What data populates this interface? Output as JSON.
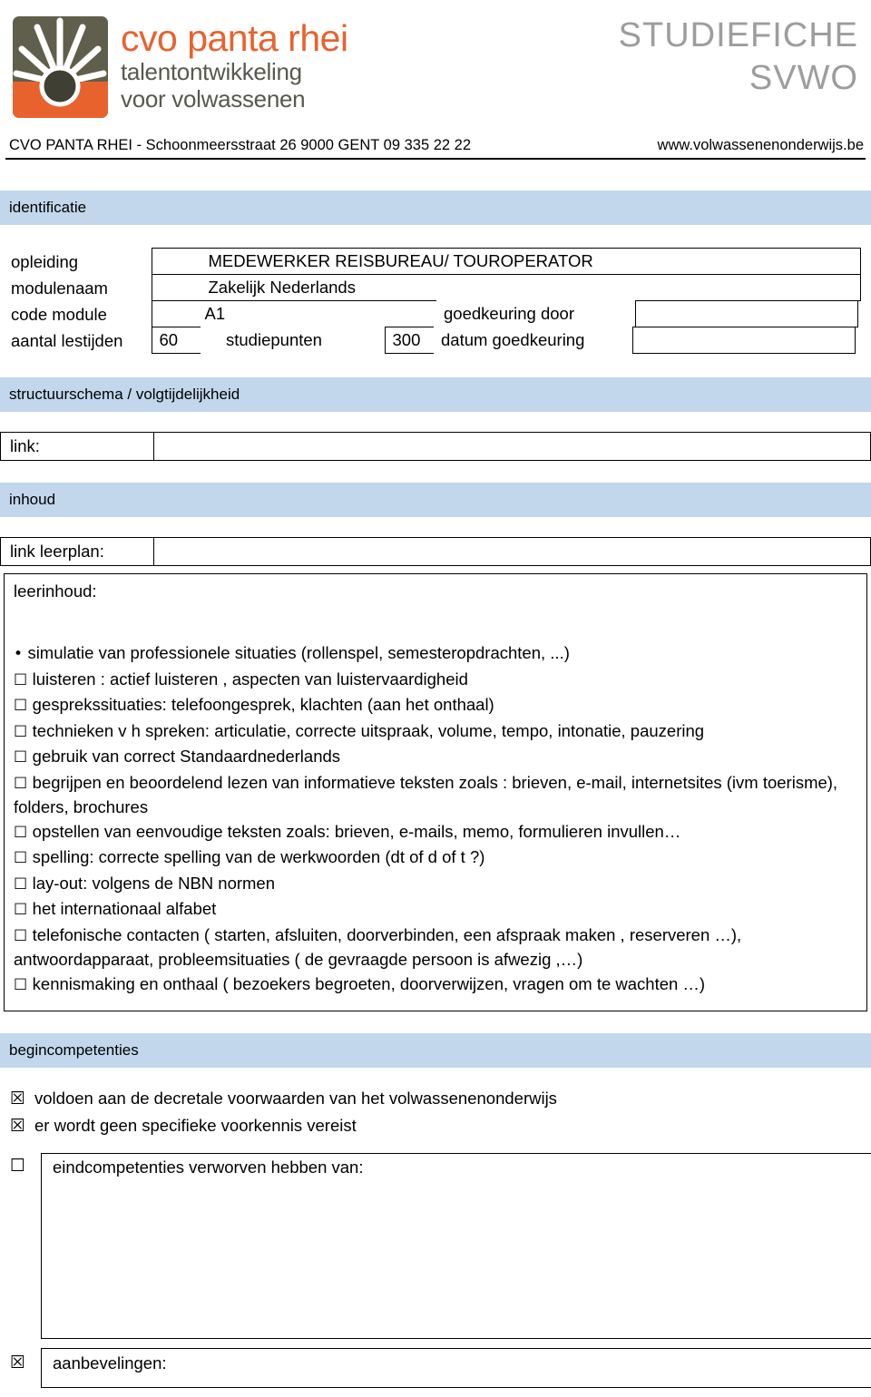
{
  "header": {
    "logo_brand": "cvo panta rhei",
    "logo_tagline_1": "talentontwikkeling",
    "logo_tagline_2": "voor volwassenen",
    "doc_title_1": "STUDIEFICHE",
    "doc_title_2": "SVWO",
    "address_left": "CVO PANTA RHEI  - Schoonmeersstraat 26   9000   GENT   09 335 22 22",
    "address_right": "www.volwassenenonderwijs.be",
    "colors": {
      "logo_orange": "#e8622e",
      "logo_olive": "#5f5f4c",
      "bar_blue": "#c2d7ec",
      "title_gray": "#9d9d9d"
    }
  },
  "sections": {
    "identificatie": "identificatie",
    "structuurschema": "structuurschema / volgtijdelijkheid",
    "inhoud": "inhoud",
    "begincompetenties": "begincompetenties"
  },
  "identificatie": {
    "label_opleiding": "opleiding",
    "value_opleiding": "MEDEWERKER REISBUREAU/ TOUROPERATOR",
    "label_modulenaam": "modulenaam",
    "value_modulenaam": "Zakelijk Nederlands",
    "label_code_module": "code module",
    "value_code_module": "A1",
    "label_goedkeuring_door": "goedkeuring door",
    "value_goedkeuring_door": "",
    "label_aantal_lestijden": "aantal lestijden",
    "value_aantal_lestijden": "60",
    "label_studiepunten": "studiepunten",
    "value_studiepunten": "300",
    "label_datum_goedkeuring": "datum goedkeuring",
    "value_datum_goedkeuring": ""
  },
  "structuurschema": {
    "label_link": "link:",
    "value_link": ""
  },
  "inhoud": {
    "label_link_leerplan": "link leerplan:",
    "value_link_leerplan": "",
    "label_leerinhoud": "leerinhoud:",
    "items": [
      {
        "marker": "•",
        "text": "simulatie van professionele situaties (rollenspel, semesteropdrachten, ...)"
      },
      {
        "marker": "☐",
        "text": "luisteren : actief luisteren , aspecten van luistervaardigheid"
      },
      {
        "marker": "☐",
        "text": "gesprekssituaties: telefoongesprek, klachten (aan het onthaal)"
      },
      {
        "marker": "☐",
        "text": "technieken v h spreken: articulatie, correcte uitspraak, volume, tempo, intonatie, pauzering"
      },
      {
        "marker": "☐",
        "text": "gebruik van correct Standaardnederlands"
      },
      {
        "marker": "☐",
        "text": "begrijpen en beoordelend lezen van informatieve teksten zoals : brieven, e-mail, internetsites (ivm toerisme), folders, brochures"
      },
      {
        "marker": "☐",
        "text": "opstellen van eenvoudige teksten zoals: brieven, e-mails, memo, formulieren invullen…"
      },
      {
        "marker": "☐",
        "text": "spelling: correcte spelling van de werkwoorden (dt of d of t ?)"
      },
      {
        "marker": "☐",
        "text": "lay-out: volgens de NBN normen"
      },
      {
        "marker": "☐",
        "text": "het internationaal alfabet"
      },
      {
        "marker": "☐",
        "text": "telefonische contacten ( starten, afsluiten, doorverbinden, een afspraak maken , reserveren …), antwoordapparaat, probleemsituaties ( de gevraagde persoon is afwezig ,…)"
      },
      {
        "marker": "☐",
        "text": "kennismaking en onthaal ( bezoekers begroeten, doorverwijzen, vragen om te wachten …)"
      }
    ]
  },
  "begincompetenties": {
    "items": [
      {
        "marker": "☒",
        "checked": true,
        "text": "voldoen aan de decretale voorwaarden van het volwassenenonderwijs"
      },
      {
        "marker": "☒",
        "checked": true,
        "text": "er wordt geen specifieke voorkennis vereist"
      }
    ],
    "eindcompetenties": {
      "marker": "☐",
      "checked": false,
      "label": "eindcompetenties verworven hebben van:",
      "value": ""
    },
    "aanbevelingen": {
      "marker": "☒",
      "checked": true,
      "label": "aanbevelingen:",
      "value": ""
    }
  }
}
